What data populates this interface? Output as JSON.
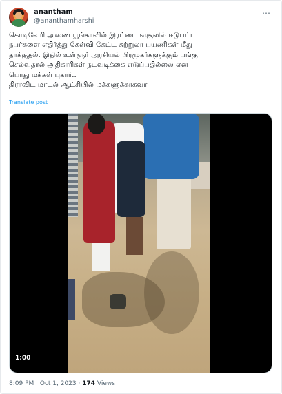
{
  "tweet": {
    "author": {
      "display_name": "anantham",
      "handle": "@ananthamharshi"
    },
    "more_icon": "more-horizontal-icon",
    "text_lines": [
      "கொடிவேரி அணை பூங்காவில் இரட்டை வசூலில் ஈடுபட்ட",
      "நபர்களை எதிர்த்து கேள்வி கேட்ட சுற்றுலா பயணிகள் மீது",
      "தாக்குதல். இதில் உள்ளூர் அரசியல் பிரமுகர்களுக்கும் பங்கு",
      "செல்வதால் அதிகாரிகள் நடவடிக்கை எடுப்பதில்லை என",
      "பொது மக்கள் புகார்..",
      "திராவிட மாடல் ஆட்சியில் மக்களுக்காகவா"
    ],
    "translate_label": "Translate post",
    "media": {
      "duration": "1:00"
    },
    "footer": {
      "time": "8:09 PM",
      "separator": " · ",
      "date": "Oct 1, 2023",
      "views_count": "174",
      "views_label": " Views"
    }
  },
  "colors": {
    "link": "#1d9bf0",
    "secondary_text": "#536471",
    "primary_text": "#0f1419"
  }
}
